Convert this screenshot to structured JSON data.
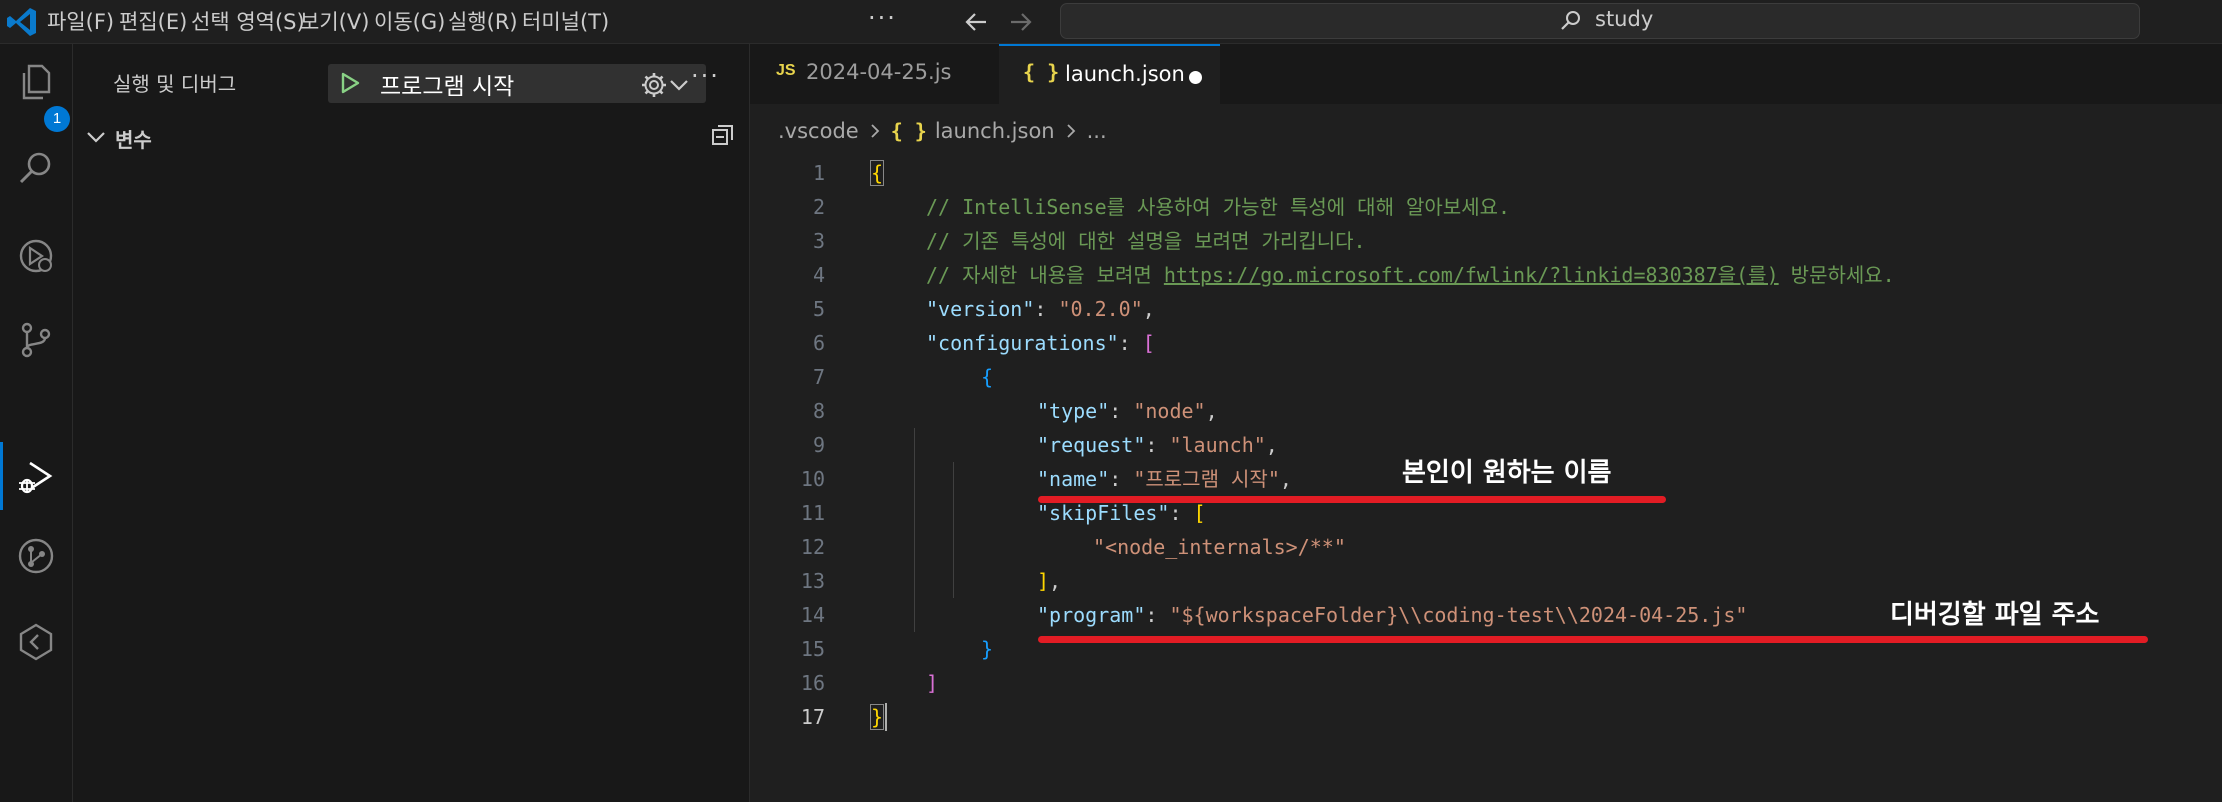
{
  "menu": {
    "items": [
      "파일(F)",
      "편집(E)",
      "선택 영역(S)",
      "보기(V)",
      "이동(G)",
      "실행(R)",
      "터미널(T)"
    ],
    "more": "···"
  },
  "command_center": {
    "label": "study",
    "icon": "search-icon"
  },
  "activity_bar": {
    "explorer_badge": "1",
    "icons": [
      "explorer-icon",
      "search-icon",
      "run-debug-icon",
      "source-control-icon",
      "run-debug-icon",
      "git-graph-icon",
      "extension-icon"
    ]
  },
  "sidebar": {
    "title": "실행 및 디버그",
    "start_config": "프로그램 시작",
    "more": "···",
    "variables_label": "변수"
  },
  "tabs": [
    {
      "icon": "JS",
      "label": "2024-04-25.js",
      "active": false
    },
    {
      "icon": "{ }",
      "label": "launch.json",
      "active": true,
      "dirty": true
    }
  ],
  "breadcrumb": {
    "folder": ".vscode",
    "file_icon": "{ }",
    "file": "launch.json",
    "rest": "..."
  },
  "editor": {
    "line_numbers": [
      "1",
      "2",
      "3",
      "4",
      "5",
      "6",
      "7",
      "8",
      "9",
      "10",
      "11",
      "12",
      "13",
      "14",
      "15",
      "16",
      "17"
    ],
    "active_line": "17",
    "lines": {
      "l1_brace": "{",
      "l2_comment": "// IntelliSense를 사용하여 가능한 특성에 대해 알아보세요.",
      "l3_comment": "// 기존 특성에 대한 설명을 보려면 가리킵니다.",
      "l4_comment_a": "// 자세한 내용을 보려면 ",
      "l4_link": "https://go.microsoft.com/fwlink/?linkid=830387을(를)",
      "l4_comment_b": " 방문하세요.",
      "l5_key": "\"version\"",
      "l5_colon": ": ",
      "l5_value": "\"0.2.0\"",
      "l5_comma": ",",
      "l6_key": "\"configurations\"",
      "l6_colon": ": ",
      "l6_bracket": "[",
      "l7_brace": "{",
      "l8_key": "\"type\"",
      "l8_colon": ": ",
      "l8_value": "\"node\"",
      "l8_comma": ",",
      "l9_key": "\"request\"",
      "l9_colon": ": ",
      "l9_value": "\"launch\"",
      "l9_comma": ",",
      "l10_key": "\"name\"",
      "l10_colon": ": ",
      "l10_value": "\"프로그램 시작\"",
      "l10_comma": ",",
      "l11_key": "\"skipFiles\"",
      "l11_colon": ": ",
      "l11_bracket": "[",
      "l12_value": "\"<node_internals>/**\"",
      "l13_bracket": "]",
      "l13_comma": ",",
      "l14_key": "\"program\"",
      "l14_colon": ": ",
      "l14_value": "\"${workspaceFolder}\\\\coding-test\\\\2024-04-25.js\"",
      "l15_brace": "}",
      "l16_bracket": "]",
      "l17_brace": "}"
    }
  },
  "annotations": {
    "name_note": "본인이 원하는 이름",
    "program_note": "디버깅할 파일 주소",
    "color": "#e21c24"
  },
  "colors": {
    "accent": "#0078d4",
    "background": "#1f1f1f",
    "sidebar": "#181818"
  }
}
